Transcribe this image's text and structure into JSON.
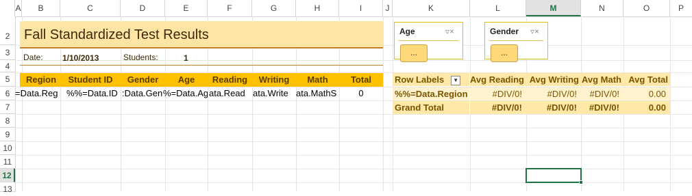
{
  "columns": [
    {
      "label": "A"
    },
    {
      "label": "B"
    },
    {
      "label": "C"
    },
    {
      "label": "D"
    },
    {
      "label": "E"
    },
    {
      "label": "F"
    },
    {
      "label": "G"
    },
    {
      "label": "H"
    },
    {
      "label": "I"
    },
    {
      "label": "J"
    },
    {
      "label": "K"
    },
    {
      "label": "L"
    },
    {
      "label": "M"
    },
    {
      "label": "N"
    },
    {
      "label": "O"
    },
    {
      "label": "P"
    }
  ],
  "rows": [
    "2",
    "3",
    "4",
    "5",
    "6",
    "7",
    "8",
    "9",
    "10",
    "11",
    "12",
    "13"
  ],
  "selected_column": "M",
  "selected_row": "12",
  "report": {
    "title": "Fall Standardized Test Results",
    "date_label": "Date:",
    "date_value": "1/10/2013",
    "students_label": "Students:",
    "students_value": "1"
  },
  "table": {
    "headers": [
      "Region",
      "Student ID",
      "Gender",
      "Age",
      "Reading",
      "Writing",
      "Math",
      "Total"
    ],
    "row": [
      "=Data.Reg",
      "%%=Data.ID",
      ":Data.Gen",
      "%=Data.Ag",
      "ata.Read",
      "ata.Write",
      "ata.MathS",
      "0"
    ]
  },
  "slicers": [
    {
      "title": "Age",
      "button": "..."
    },
    {
      "title": "Gender",
      "button": "..."
    }
  ],
  "pivot": {
    "headers": [
      "Row Labels",
      "Avg Reading",
      "Avg Writing",
      "Avg Math",
      "Avg Total"
    ],
    "rows": [
      [
        "%%=Data.Region",
        "#DIV/0!",
        "#DIV/0!",
        "#DIV/0!",
        "0.00"
      ],
      [
        "Grand Total",
        "#DIV/0!",
        "#DIV/0!",
        "#DIV/0!",
        "0.00"
      ]
    ]
  },
  "colors": {
    "accent": "#ffc000",
    "title_fill": "#ffe5a3",
    "selection": "#217346"
  }
}
